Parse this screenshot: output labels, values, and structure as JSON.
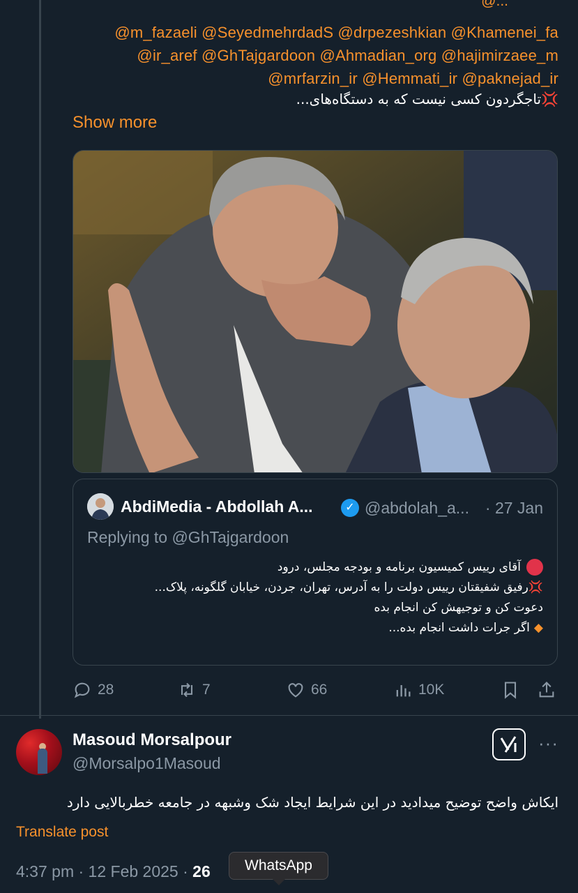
{
  "tweet": {
    "cut_text": "@...",
    "mentions_lines": [
      "@m_fazaeli @SeyedmehrdadS @drpezeshkian @Khamenei_fa",
      "@ir_aref @GhTajgardoon @Ahmadian_org @hajimirzaee_m",
      "@mrfarzin_ir @Hemmati_ir @paknejad_ir"
    ],
    "persian_line": "تاجگردون کسی نیست که به دستگاه‌های...",
    "emoji_symbol": "💢",
    "show_more": "Show more",
    "quote": {
      "name": "AbdiMedia - Abdollah A...",
      "handle": "@abdolah_a...",
      "date": "· 27 Jan",
      "replying_to": "Replying to @GhTajgardoon",
      "line1": "آقای رییس کمیسیون برنامه و بودجه مجلس، درود",
      "line2": "رفیق شفیقتان رییس دولت را به آدرس، تهران، جردن، خیابان گلگونه، پلاک...",
      "line3": "دعوت کن و توجیهش کن انجام بده",
      "line4": "اگر جرات داشت انجام بده...",
      "verified_color": "#1d9bf0"
    },
    "actions": {
      "replies": "28",
      "reposts": "7",
      "likes": "66",
      "views": "10K"
    }
  },
  "reply": {
    "name": "Masoud Morsalpour",
    "handle": "@Morsalpo1Masoud",
    "body": "ایکاش واضح توضیح میدادید در این شرایط ایجاد شک وشبهه در جامعه خطربالایی دارد",
    "translate": "Translate post",
    "time": "4:37 pm · 12 Feb 2025 · ",
    "views_partial": "26",
    "more_label": "···"
  },
  "tooltip": "WhatsApp",
  "colors": {
    "background": "#15202b",
    "accent": "#f7912c",
    "muted": "#8b98a5",
    "border": "#38444d"
  }
}
